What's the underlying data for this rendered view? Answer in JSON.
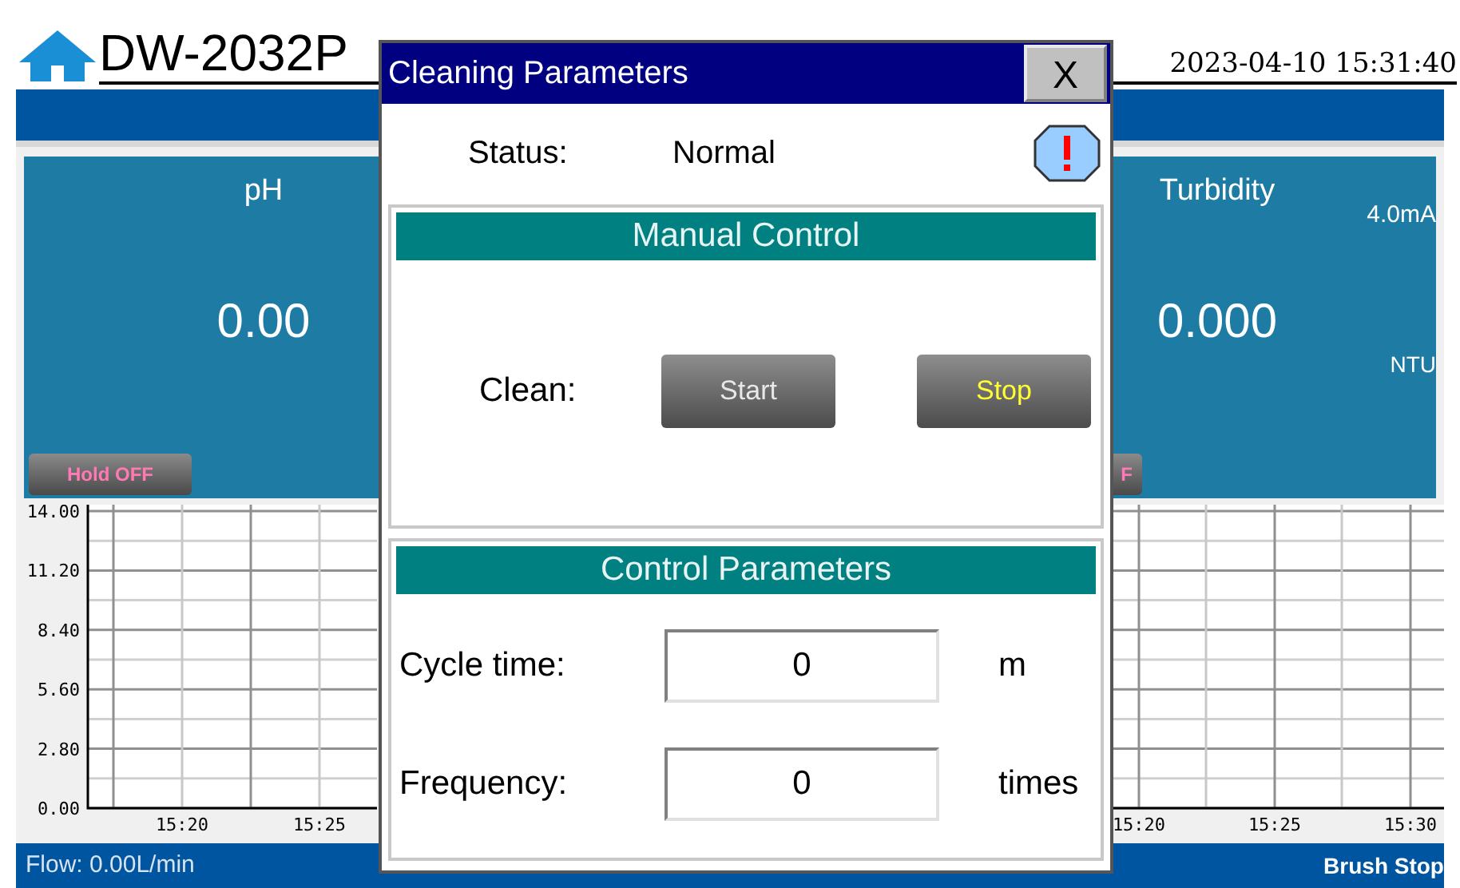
{
  "header": {
    "title": "DW-2032P",
    "datetime": "2023-04-10 15:31:40"
  },
  "panels": [
    {
      "title": "pH",
      "value": "0.00",
      "hold_button": "Hold OFF"
    },
    {
      "title": "Turbidity",
      "range": "4.0mA",
      "value": "0.000",
      "unit": "NTU",
      "hold_button": "F"
    }
  ],
  "charts": [
    {
      "chart_data": {
        "type": "line",
        "grid": true,
        "ylim": [
          0,
          14
        ],
        "categories": [
          "15:20",
          "15:25"
        ],
        "yticks": [
          {
            "value": 0,
            "label": "0.00"
          },
          {
            "value": 2.8,
            "label": "2.80"
          },
          {
            "value": 5.6,
            "label": "5.60"
          },
          {
            "value": 8.4,
            "label": "8.40"
          },
          {
            "value": 11.2,
            "label": "11.20"
          },
          {
            "value": 14,
            "label": "14.00"
          }
        ]
      }
    },
    {
      "chart_data": {
        "type": "other",
        "categories": [
          "15:20",
          "15:25",
          "15:30"
        ]
      }
    }
  ],
  "status_bar": {
    "flow": "Flow: 0.00L/min",
    "brush": "Brush Stop"
  },
  "dialog": {
    "title": "Cleaning Parameters",
    "close": "X",
    "status_label": "Status:",
    "status_value": "Normal",
    "manual": {
      "heading": "Manual Control",
      "label": "Clean:",
      "buttons": [
        {
          "label": "Start",
          "kind": "start"
        },
        {
          "label": "Stop",
          "kind": "stop"
        }
      ]
    },
    "params": {
      "heading": "Control Parameters",
      "fields": [
        {
          "label": "Cycle time:",
          "value": "0",
          "unit": "m"
        },
        {
          "label": "Frequency:",
          "value": "0",
          "unit": "times"
        }
      ]
    }
  }
}
